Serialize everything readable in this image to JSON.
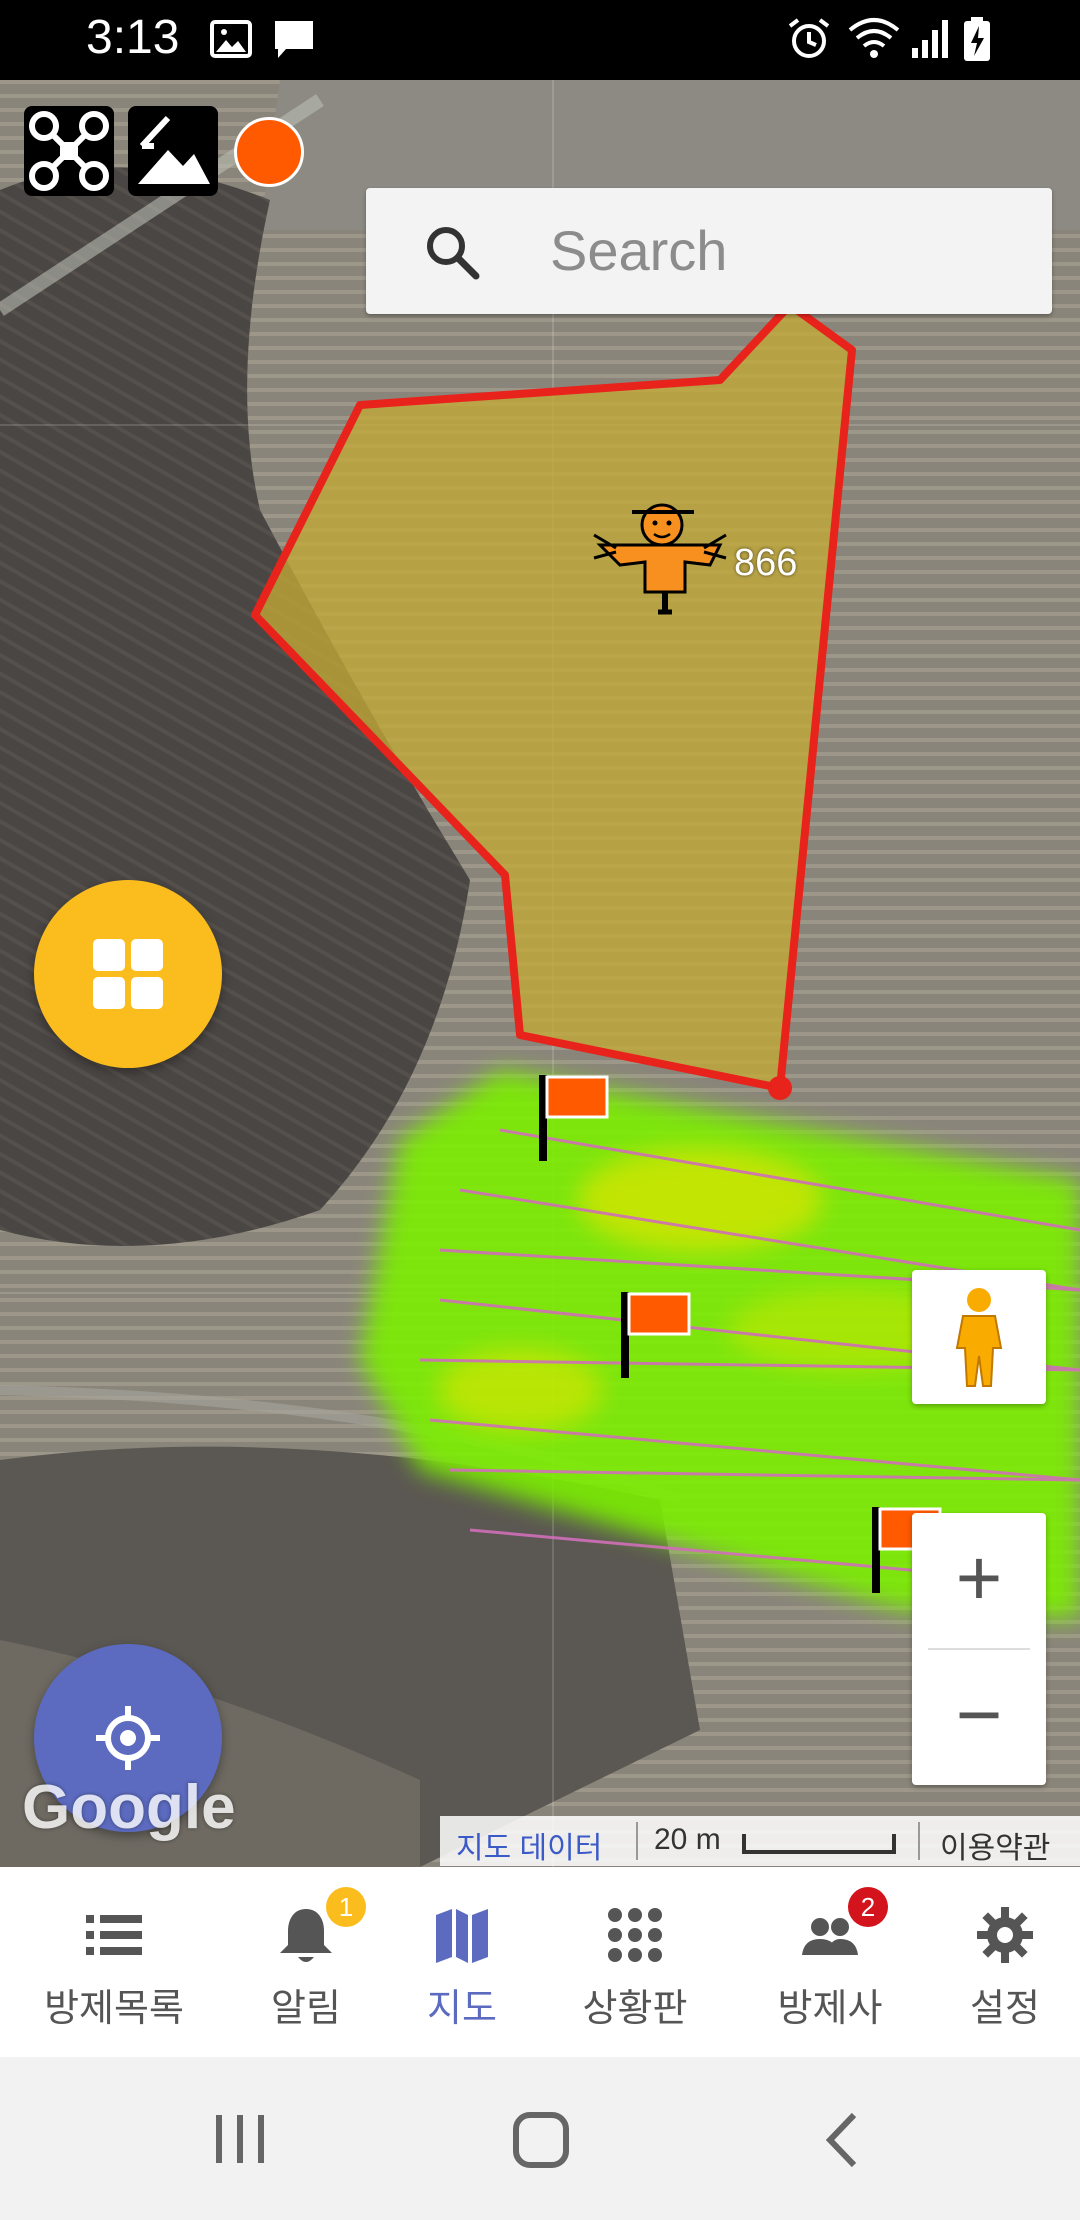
{
  "status_bar": {
    "time": "3:13",
    "left_icons": [
      "gallery-icon",
      "message-icon"
    ],
    "right_icons": [
      "alarm-icon",
      "wifi-icon",
      "signal-icon",
      "battery-charging-icon"
    ]
  },
  "map": {
    "search": {
      "placeholder": "Search"
    },
    "top_left_icons": [
      "drone-icon",
      "terrain-icon",
      "status-dot-icon"
    ],
    "field_marker_label": "866",
    "field_marker_icon": "scarecrow-icon",
    "flags": [
      "flag-icon",
      "flag-icon",
      "flag-icon"
    ],
    "menu_button_icon": "grid-icon",
    "locate_button_icon": "locate-icon",
    "street_view_icon": "pegman-icon",
    "zoom_in_label": "+",
    "zoom_out_label": "−",
    "watermark": "Google",
    "attribution": {
      "map_data": "지도 데이터",
      "scale": "20 m",
      "terms": "이용약관"
    },
    "colors": {
      "field_outline": "#e8231b",
      "field_fill": "#b8a030",
      "heatmap": "#7cf000",
      "menu_button": "#fbbd1e",
      "locate_button": "#5c6bc0",
      "status_dot": "#ff5a00"
    }
  },
  "bottom_nav": {
    "active_color": "#5c6bc0",
    "items": [
      {
        "label": "방제목록",
        "icon": "list-icon",
        "badge": ""
      },
      {
        "label": "알림",
        "icon": "bell-icon",
        "badge": "1"
      },
      {
        "label": "지도",
        "icon": "map-icon",
        "badge": "",
        "active": true
      },
      {
        "label": "상황판",
        "icon": "dashboard-icon",
        "badge": ""
      },
      {
        "label": "방제사",
        "icon": "people-icon",
        "badge": "2"
      },
      {
        "label": "설정",
        "icon": "gear-icon",
        "badge": ""
      }
    ]
  },
  "system_nav": [
    "recents-icon",
    "home-icon",
    "back-icon"
  ]
}
